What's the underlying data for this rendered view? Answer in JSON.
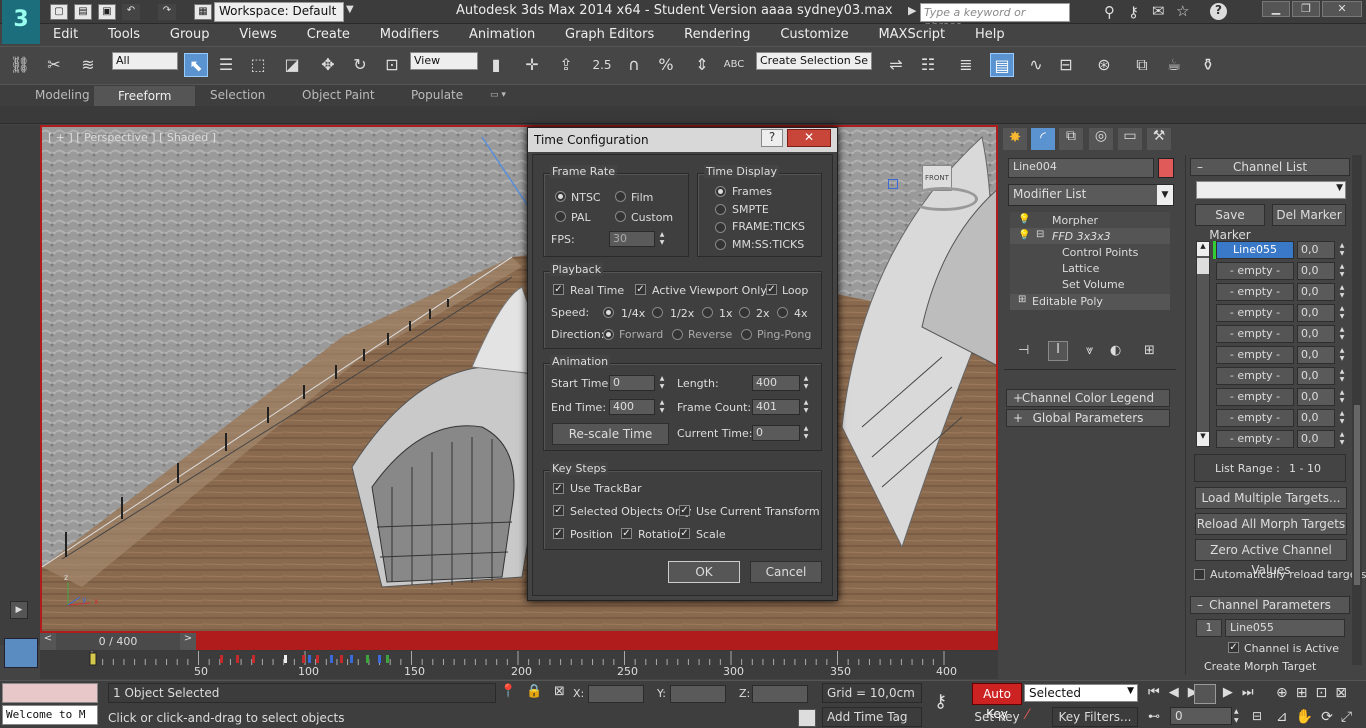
{
  "app": {
    "title": "Autodesk 3ds Max  2014 x64  - Student Version     aaaa sydney03.max",
    "workspace": "Workspace: Default",
    "search_placeholder": "Type a keyword or phrase",
    "logo": "3"
  },
  "menu": [
    "Edit",
    "Tools",
    "Group",
    "Views",
    "Create",
    "Modifiers",
    "Animation",
    "Graph Editors",
    "Rendering",
    "Customize",
    "MAXScript",
    "Help"
  ],
  "toolbar": {
    "selection_filter": "All",
    "ref_coord": "View",
    "snap_angle": "2.5",
    "percent": "%",
    "named_selection": "Create Selection Se"
  },
  "ribbon": {
    "tabs": [
      "Modeling",
      "Freeform",
      "Selection",
      "Object Paint",
      "Populate"
    ],
    "active": "Freeform"
  },
  "viewport": {
    "label": "[ + ] [ Perspective ] [ Shaded ]",
    "cube_label": "FRONT"
  },
  "dialog": {
    "title": "Time Configuration",
    "help": "?",
    "close": "✕",
    "frame_rate": {
      "label": "Frame Rate",
      "options": [
        "NTSC",
        "Film",
        "PAL",
        "Custom"
      ],
      "selected": "NTSC",
      "fps_label": "FPS:",
      "fps": "30"
    },
    "time_display": {
      "label": "Time Display",
      "options": [
        "Frames",
        "SMPTE",
        "FRAME:TICKS",
        "MM:SS:TICKS"
      ],
      "selected": "Frames"
    },
    "playback": {
      "label": "Playback",
      "real_time": "Real Time",
      "active_viewport": "Active Viewport Only",
      "loop": "Loop",
      "speed_label": "Speed:",
      "speeds": [
        "1/4x",
        "1/2x",
        "1x",
        "2x",
        "4x"
      ],
      "speed_selected": "1/4x",
      "direction_label": "Direction:",
      "directions": [
        "Forward",
        "Reverse",
        "Ping-Pong"
      ],
      "direction_selected": "Forward"
    },
    "animation": {
      "label": "Animation",
      "start_label": "Start Time:",
      "start": "0",
      "end_label": "End Time:",
      "end": "400",
      "length_label": "Length:",
      "length": "400",
      "count_label": "Frame Count:",
      "count": "401",
      "current_label": "Current Time:",
      "current": "0",
      "rescale": "Re-scale Time"
    },
    "key_steps": {
      "label": "Key Steps",
      "use_trackbar": "Use TrackBar",
      "selected_only": "Selected Objects Only",
      "use_current": "Use Current Transform",
      "position": "Position",
      "rotation": "Rotation",
      "scale": "Scale"
    },
    "ok": "OK",
    "cancel": "Cancel"
  },
  "command_panel": {
    "object_name": "Line004",
    "object_color": "#e05a5a",
    "modifier_list": "Modifier List",
    "stack": [
      "Morpher",
      "FFD 3x3x3",
      "Control Points",
      "Lattice",
      "Set Volume",
      "Editable Poly"
    ],
    "rollouts": [
      "Channel Color Legend",
      "Global Parameters"
    ]
  },
  "morph_panel": {
    "channel_list": "Channel List",
    "save_marker": "Save Marker",
    "del_marker": "Del Marker",
    "channels": [
      "Line055",
      "- empty -",
      "- empty -",
      "- empty -",
      "- empty -",
      "- empty -",
      "- empty -",
      "- empty -",
      "- empty -",
      "- empty -"
    ],
    "values": [
      "0,0",
      "0,0",
      "0,0",
      "0,0",
      "0,0",
      "0,0",
      "0,0",
      "0,0",
      "0,0",
      "0,0"
    ],
    "list_range_label": "List Range :",
    "list_range": "1 - 10",
    "load_multiple": "Load Multiple Targets...",
    "reload_all": "Reload All Morph Targets",
    "zero_active": "Zero Active Channel Values",
    "auto_reload": "Automatically reload targets",
    "channel_params": "Channel Parameters",
    "channel_num": "1",
    "channel_name": "Line055",
    "channel_active": "Channel is Active",
    "create_target": "Create Morph Target"
  },
  "timeline": {
    "position": "0 / 400",
    "ticks": [
      "50",
      "100",
      "150",
      "200",
      "250",
      "300",
      "350",
      "400"
    ]
  },
  "status": {
    "maxscript": "Welcome to M",
    "selected": "1 Object Selected",
    "prompt": "Click or click-and-drag to select objects",
    "x_label": "X:",
    "y_label": "Y:",
    "z_label": "Z:",
    "grid": "Grid = 10,0cm",
    "add_time_tag": "Add Time Tag",
    "auto_key": "Auto Key",
    "set_key": "Set Key",
    "key_mode": "Selected",
    "key_filters": "Key Filters...",
    "frame": "0"
  }
}
